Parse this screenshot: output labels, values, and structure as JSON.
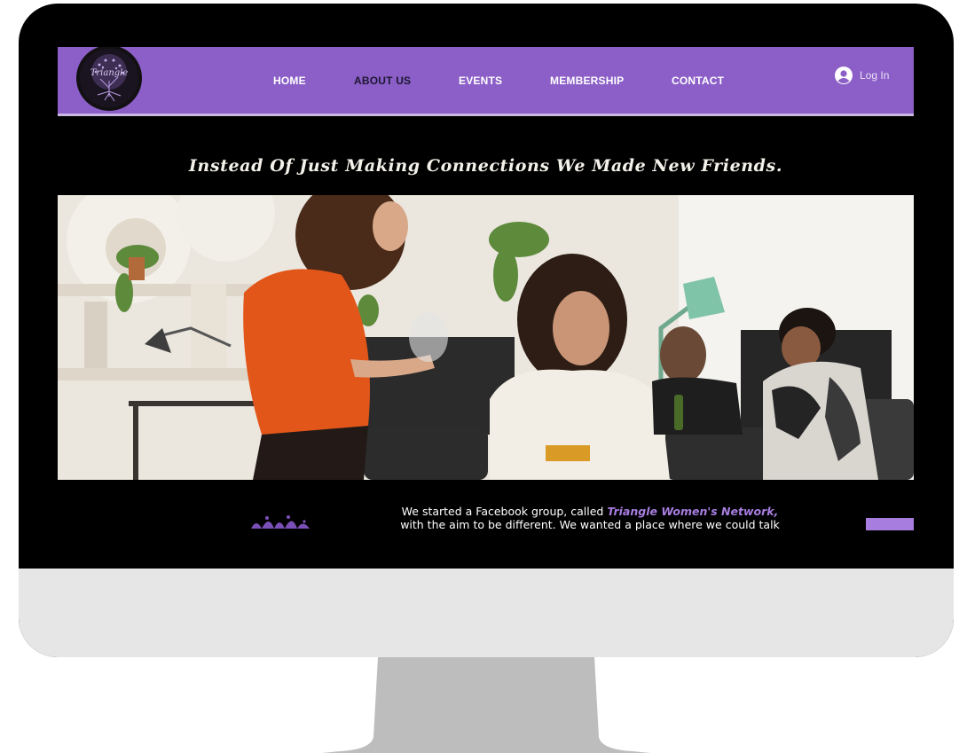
{
  "logo": {
    "text": "Triangle"
  },
  "nav": {
    "items": [
      {
        "label": "HOME",
        "active": false
      },
      {
        "label": "ABOUT US",
        "active": true
      },
      {
        "label": "EVENTS",
        "active": false
      },
      {
        "label": "MEMBERSHIP",
        "active": false
      },
      {
        "label": "CONTACT",
        "active": false
      }
    ],
    "login_label": "Log In"
  },
  "headline": "Instead Of Just Making Connections We Made New Friends.",
  "intro": {
    "before": "We started a Facebook group, called ",
    "highlight": "Triangle Women's Network,",
    "after": "with the aim to be different. We wanted a place where we could talk"
  },
  "colors": {
    "nav_bg": "#8b5fc7",
    "accent": "#a77de0",
    "monitor_frame": "#000000",
    "monitor_chin": "#e6e6e6",
    "stand": "#bdbdbd"
  }
}
